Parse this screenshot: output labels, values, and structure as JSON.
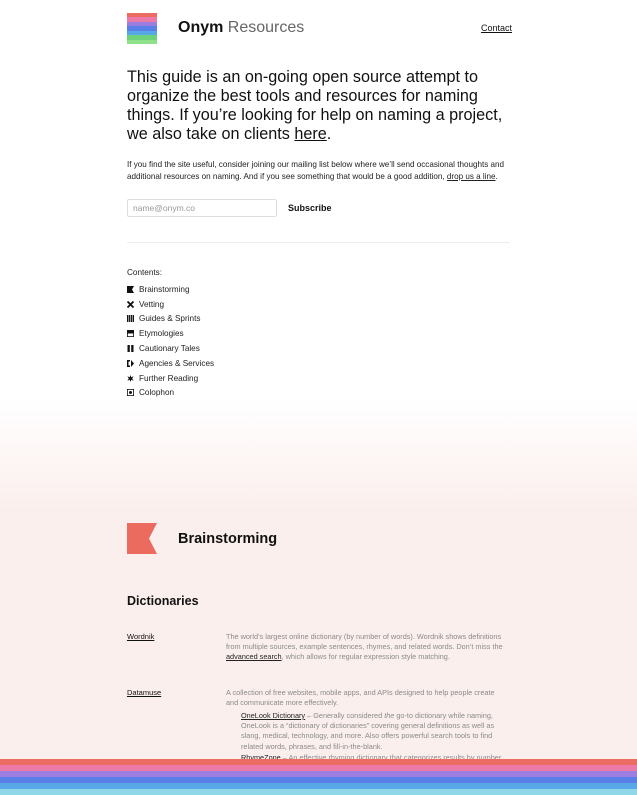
{
  "brand": {
    "name_bold": "Onym",
    "name_light": " Resources",
    "stripe_colors": [
      "#ec6b63",
      "#ec7aa8",
      "#9b7fe0",
      "#5b7fe8",
      "#58a8e8",
      "#6dd27b",
      "#8fe08a"
    ]
  },
  "nav": {
    "contact": "Contact"
  },
  "intro": {
    "text": "This guide is an on-going open source attempt to organize the best tools and resources for naming things. If you’re looking for help on naming a project, we also take on clients ",
    "link": "here",
    "end": "."
  },
  "sub": {
    "text": "If you find the site useful, consider joining our mailing list below where we’ll send occasional thoughts and additional resources on naming. And if you see something that would be a good addition, ",
    "link": "drop us a line",
    "end": "."
  },
  "signup": {
    "placeholder": "name@onym.co",
    "button": "Subscribe"
  },
  "contents": {
    "label": "Contents:",
    "items": [
      {
        "label": "Brainstorming",
        "icon": "flag-icon"
      },
      {
        "label": "Vetting",
        "icon": "cross-icon"
      },
      {
        "label": "Guides & Sprints",
        "icon": "grid-icon"
      },
      {
        "label": "Etymologies",
        "icon": "half-square-icon"
      },
      {
        "label": "Cautionary Tales",
        "icon": "pause-icon"
      },
      {
        "label": "Agencies & Services",
        "icon": "bracket-icon"
      },
      {
        "label": "Further Reading",
        "icon": "burst-icon"
      },
      {
        "label": "Colophon",
        "icon": "dot-square-icon"
      }
    ]
  },
  "section": {
    "title": "Brainstorming",
    "icon_color": "#ec6b5f",
    "subheading": "Dictionaries",
    "entries": [
      {
        "name": "Wordnik",
        "desc": "The world’s largest online dictionary (by number of words). Wordnik shows definitions from multiple sources, example sentences, rhymes, and related words. Don’t miss the ",
        "link": "advanced search",
        "desc_end": ", which allows for regular expression style matching."
      },
      {
        "name": "Datamuse",
        "desc": "A collection of free websites, mobile apps, and APIs designed to help people create and communicate more effectively."
      }
    ],
    "sub_entries": [
      {
        "name": "OneLook Dictionary",
        "pre": " – Generally considered ",
        "em": "the",
        "post": " go-to dictionary while naming, OneLook is a “dictionary of dictionaries” covering general definitions as well as slang, medical, technology, and more. Also offers powerful search tools to find related words, phrases, and fill-in-the-blank."
      },
      {
        "name": "RhymeZone",
        "pre": " – An effective rhyming dictionary that categorizes results by number of"
      }
    ]
  },
  "footer_stripes": [
    "#ec6b63",
    "#ec7aa8",
    "#9b7fe0",
    "#5b7fe8",
    "#58a8e8",
    "#8fd8e8"
  ]
}
